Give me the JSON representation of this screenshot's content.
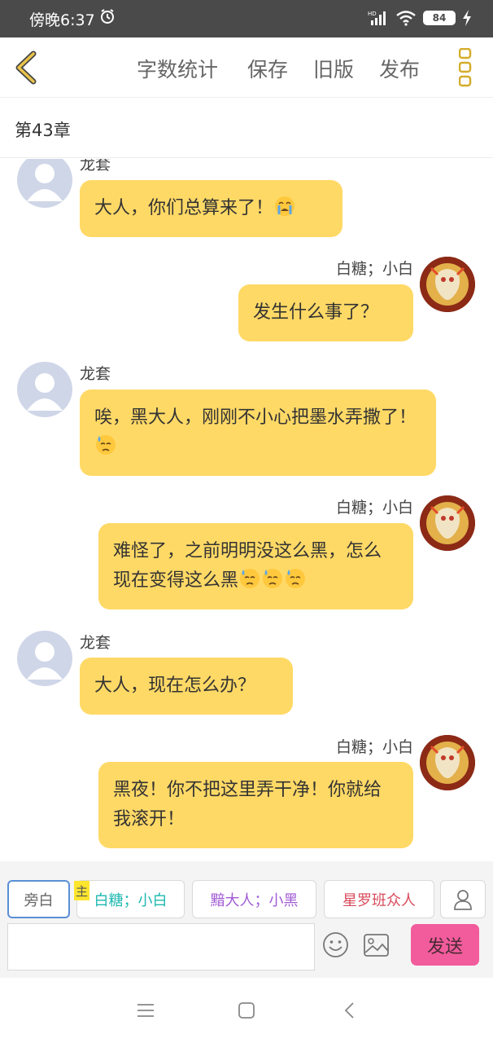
{
  "status_bar": {
    "time": "傍晚6:37",
    "network": "HD",
    "battery": "84",
    "icons": [
      "alarm-icon",
      "signal-icon",
      "wifi-icon",
      "battery-icon",
      "charging-icon"
    ]
  },
  "toolbar": {
    "back_icon": "chevron-left-icon",
    "word_count": "字数统计",
    "save": "保存",
    "old_version": "旧版",
    "publish": "发布",
    "more_icon": "more-vertical-icon"
  },
  "chapter": {
    "title": "第43章"
  },
  "messages": [
    {
      "name": "龙套",
      "text": "大人，你们总算来了！",
      "emojis": [
        "crying-face-emoji"
      ]
    },
    {
      "name": "白糖；小白",
      "text": "发生什么事了？",
      "emojis": []
    },
    {
      "name": "龙套",
      "text": "唉，黑大人，刚刚不小心把墨水弄撒了！",
      "emojis": [
        "sweat-face-emoji"
      ]
    },
    {
      "name": "白糖；小白",
      "text": "难怪了，之前明明没这么黑，怎么现在变得这么黑",
      "emojis": [
        "sweat-face-emoji",
        "sweat-face-emoji",
        "sweat-face-emoji"
      ]
    },
    {
      "name": "龙套",
      "text": "大人，现在怎么办？",
      "emojis": []
    },
    {
      "name": "白糖；小白",
      "text": "黑夜！你不把这里弄干净！你就给我滚开！",
      "emojis": []
    }
  ],
  "roles": {
    "aside": "旁白",
    "host_badge": "主",
    "baitang": "白糖；小白",
    "an": "黯大人；小黑",
    "xingluo": "星罗班众人",
    "person_icon": "person-icon"
  },
  "composer": {
    "input_value": "",
    "emoji_icon": "smiley-icon",
    "image_icon": "image-icon",
    "send": "发送"
  },
  "nav": {
    "icons": [
      "menu-icon",
      "home-icon",
      "back-icon"
    ]
  },
  "colors": {
    "bubble": "#ffd966",
    "send_button": "#f25c9c",
    "toolbar_accent": "#d4ac2b"
  }
}
